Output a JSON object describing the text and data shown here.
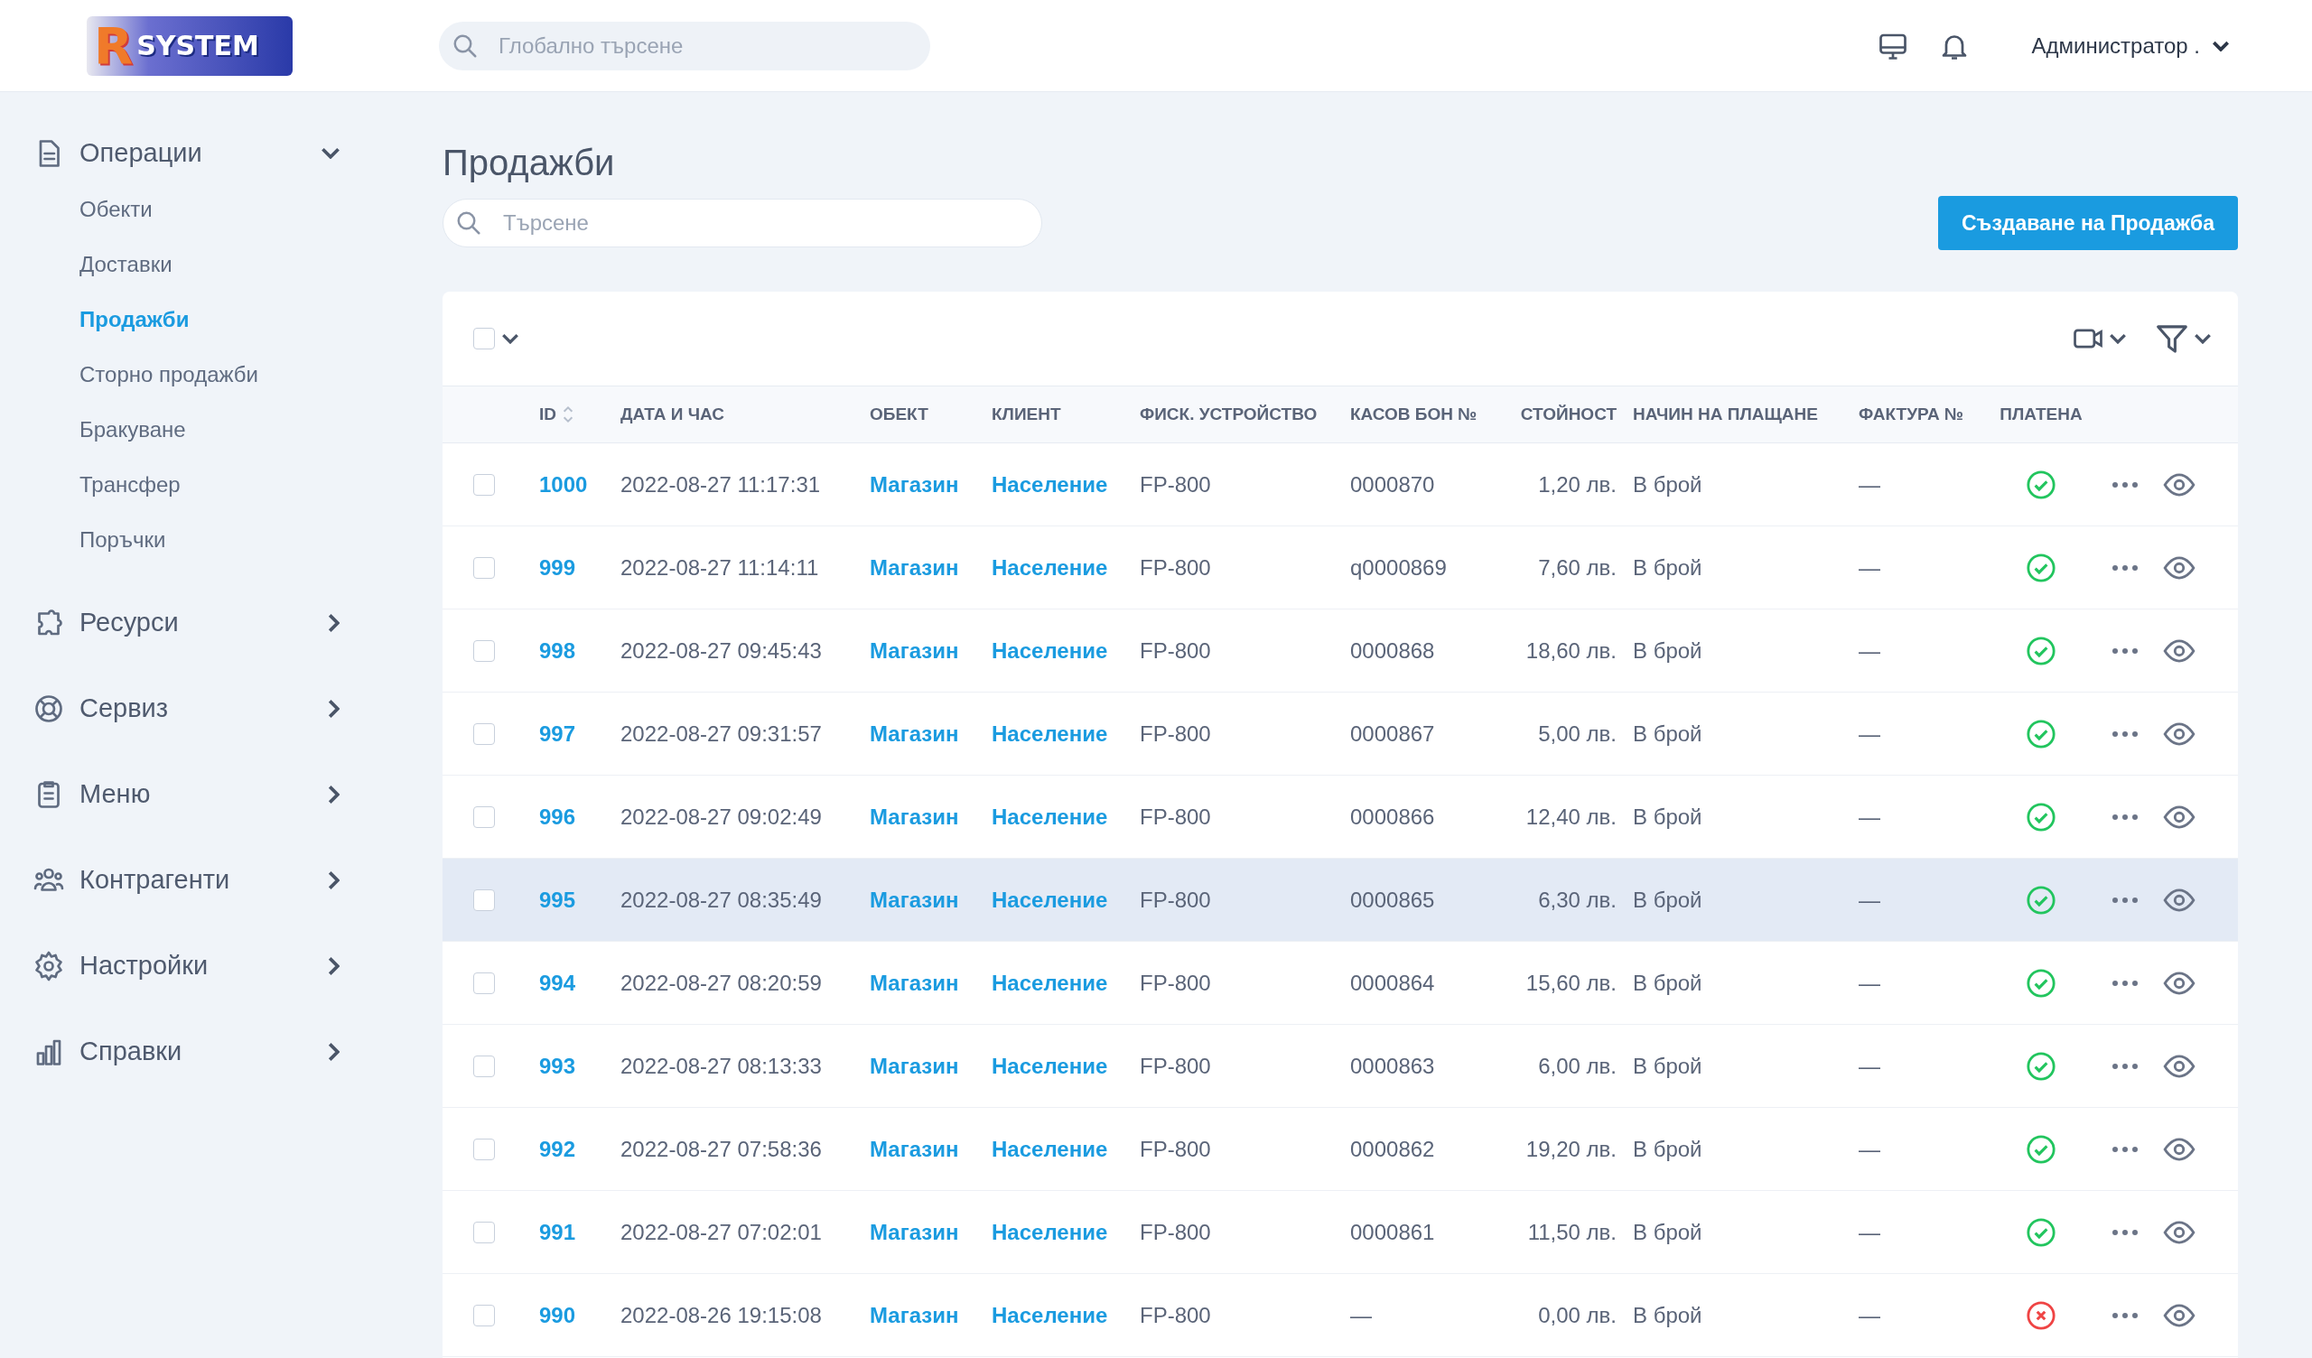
{
  "header": {
    "logo": {
      "letter": "R",
      "text": "SYSTEM"
    },
    "search": {
      "placeholder": "Глобално търсене"
    },
    "user": "Администратор ."
  },
  "sidebar": {
    "items": [
      {
        "label": "Операции",
        "expanded": true,
        "children": [
          {
            "label": "Обекти",
            "selected": false
          },
          {
            "label": "Доставки",
            "selected": false
          },
          {
            "label": "Продажби",
            "selected": true
          },
          {
            "label": "Сторно продажби",
            "selected": false
          },
          {
            "label": "Бракуване",
            "selected": false
          },
          {
            "label": "Трансфер",
            "selected": false
          },
          {
            "label": "Поръчки",
            "selected": false
          }
        ]
      },
      {
        "label": "Ресурси",
        "expanded": false
      },
      {
        "label": "Сервиз",
        "expanded": false
      },
      {
        "label": "Меню",
        "expanded": false
      },
      {
        "label": "Контрагенти",
        "expanded": false
      },
      {
        "label": "Настройки",
        "expanded": false
      },
      {
        "label": "Справки",
        "expanded": false
      }
    ]
  },
  "page": {
    "title": "Продажби",
    "search": {
      "placeholder": "Търсене"
    },
    "create_button": "Създаване на Продажба"
  },
  "table": {
    "select_all": {
      "checked": false
    },
    "columns": [
      "ID",
      "ДАТА И ЧАС",
      "ОБЕКТ",
      "КЛИЕНТ",
      "ФИСК. УСТРОЙСТВО",
      "КАСОВ БОН №",
      "СТОЙНОСТ",
      "НАЧИН НА ПЛАЩАНЕ",
      "ФАКТУРА №",
      "ПЛАТЕНА"
    ],
    "rows": [
      {
        "id": "1000",
        "datetime": "2022-08-27 11:17:31",
        "object": "Магазин",
        "client": "Население",
        "device": "FP-800",
        "receipt": "0000870",
        "amount": "1,20 лв.",
        "payment": "В брой",
        "invoice": "—",
        "paid": true,
        "checked": false,
        "hovered": false
      },
      {
        "id": "999",
        "datetime": "2022-08-27 11:14:11",
        "object": "Магазин",
        "client": "Население",
        "device": "FP-800",
        "receipt": "q0000869",
        "amount": "7,60 лв.",
        "payment": "В брой",
        "invoice": "—",
        "paid": true,
        "checked": false,
        "hovered": false
      },
      {
        "id": "998",
        "datetime": "2022-08-27 09:45:43",
        "object": "Магазин",
        "client": "Население",
        "device": "FP-800",
        "receipt": "0000868",
        "amount": "18,60 лв.",
        "payment": "В брой",
        "invoice": "—",
        "paid": true,
        "checked": false,
        "hovered": false
      },
      {
        "id": "997",
        "datetime": "2022-08-27 09:31:57",
        "object": "Магазин",
        "client": "Население",
        "device": "FP-800",
        "receipt": "0000867",
        "amount": "5,00 лв.",
        "payment": "В брой",
        "invoice": "—",
        "paid": true,
        "checked": false,
        "hovered": false
      },
      {
        "id": "996",
        "datetime": "2022-08-27 09:02:49",
        "object": "Магазин",
        "client": "Население",
        "device": "FP-800",
        "receipt": "0000866",
        "amount": "12,40 лв.",
        "payment": "В брой",
        "invoice": "—",
        "paid": true,
        "checked": false,
        "hovered": false
      },
      {
        "id": "995",
        "datetime": "2022-08-27 08:35:49",
        "object": "Магазин",
        "client": "Население",
        "device": "FP-800",
        "receipt": "0000865",
        "amount": "6,30 лв.",
        "payment": "В брой",
        "invoice": "—",
        "paid": true,
        "checked": false,
        "hovered": true
      },
      {
        "id": "994",
        "datetime": "2022-08-27 08:20:59",
        "object": "Магазин",
        "client": "Население",
        "device": "FP-800",
        "receipt": "0000864",
        "amount": "15,60 лв.",
        "payment": "В брой",
        "invoice": "—",
        "paid": true,
        "checked": false,
        "hovered": false
      },
      {
        "id": "993",
        "datetime": "2022-08-27 08:13:33",
        "object": "Магазин",
        "client": "Население",
        "device": "FP-800",
        "receipt": "0000863",
        "amount": "6,00 лв.",
        "payment": "В брой",
        "invoice": "—",
        "paid": true,
        "checked": false,
        "hovered": false
      },
      {
        "id": "992",
        "datetime": "2022-08-27 07:58:36",
        "object": "Магазин",
        "client": "Население",
        "device": "FP-800",
        "receipt": "0000862",
        "amount": "19,20 лв.",
        "payment": "В брой",
        "invoice": "—",
        "paid": true,
        "checked": false,
        "hovered": false
      },
      {
        "id": "991",
        "datetime": "2022-08-27 07:02:01",
        "object": "Магазин",
        "client": "Население",
        "device": "FP-800",
        "receipt": "0000861",
        "amount": "11,50 лв.",
        "payment": "В брой",
        "invoice": "—",
        "paid": true,
        "checked": false,
        "hovered": false
      },
      {
        "id": "990",
        "datetime": "2022-08-26 19:15:08",
        "object": "Магазин",
        "client": "Население",
        "device": "FP-800",
        "receipt": "—",
        "amount": "0,00 лв.",
        "payment": "В брой",
        "invoice": "—",
        "paid": false,
        "checked": false,
        "hovered": false
      }
    ]
  }
}
